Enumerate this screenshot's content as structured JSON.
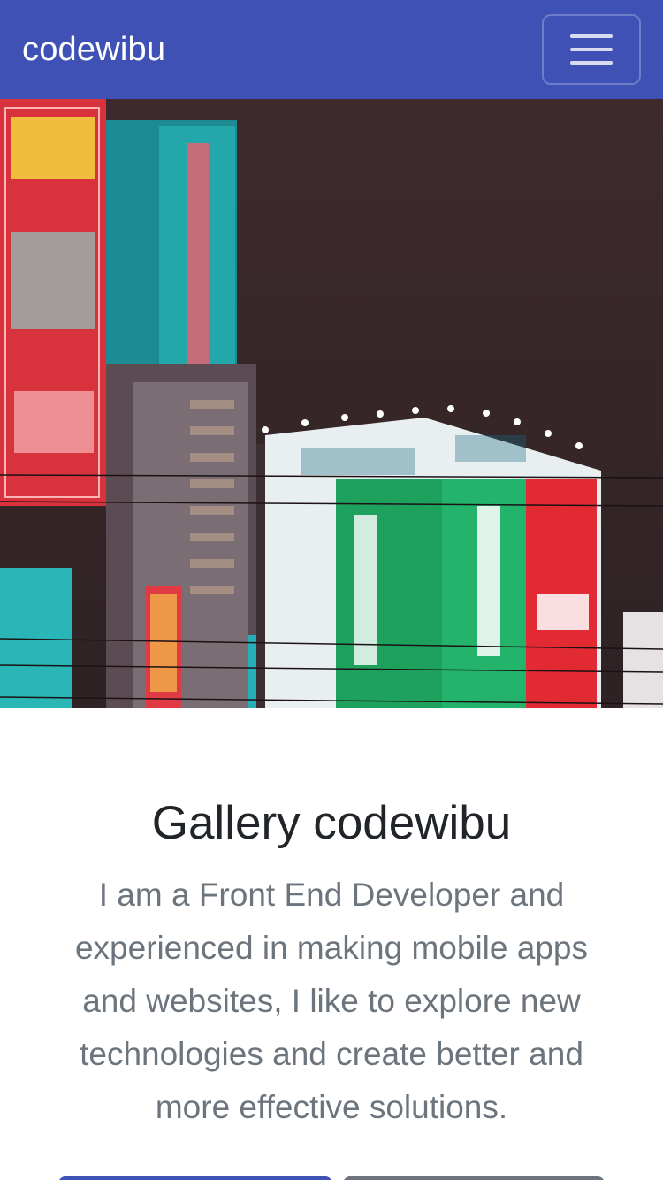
{
  "navbar": {
    "brand": "codewibu",
    "toggle_icon": "hamburger-menu-icon"
  },
  "hero": {
    "image_icon": "city-night-photo"
  },
  "main": {
    "title": "Gallery codewibu",
    "description": "I am a Front End Developer and experienced in making mobile apps and websites, I like to explore new technologies and create better and more effective solutions."
  },
  "colors": {
    "navbar": "#3f51b5",
    "title": "#212529",
    "description": "#6c757d",
    "primary_button": "#3f51b5",
    "secondary_button": "#6c757d"
  }
}
